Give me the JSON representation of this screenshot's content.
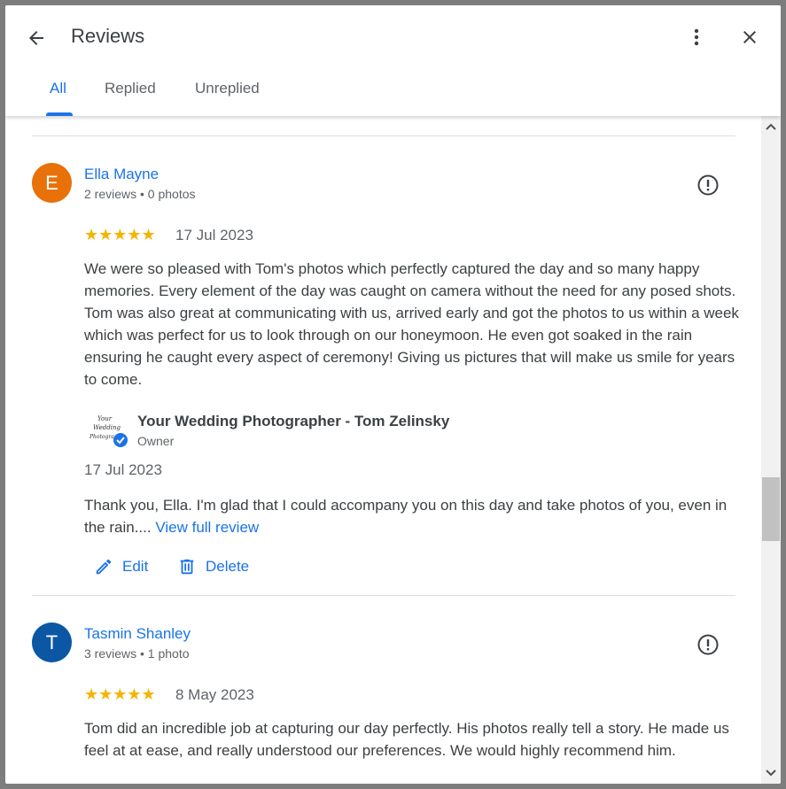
{
  "header": {
    "title": "Reviews",
    "back_icon": "arrow-back-icon",
    "more_icon": "more-vert-icon",
    "close_icon": "close-icon"
  },
  "tabs": [
    {
      "label": "All",
      "active": true
    },
    {
      "label": "Replied",
      "active": false
    },
    {
      "label": "Unreplied",
      "active": false
    }
  ],
  "reviews": [
    {
      "initial": "E",
      "avatar_color": "#e8710a",
      "name": "Ella Mayne",
      "meta": "2 reviews • 0 photos",
      "stars": "★★★★★",
      "rating": 5,
      "date": "17 Jul 2023",
      "text": "We were so pleased with Tom's photos which perfectly captured the day and so many happy memories. Every element of the day was caught on camera without the need for any posed shots. Tom was also great at communicating with us, arrived early and got the photos to us within a week which was perfect for us to look through on our honeymoon. He even got soaked in the rain ensuring he caught every aspect of ceremony! Giving us pictures that will make us smile for years to come.",
      "reply": {
        "owner_name": "Your Wedding Photographer - Tom Zelinsky",
        "owner_role": "Owner",
        "logo_text": [
          "Your",
          "Wedding",
          "Photography"
        ],
        "date": "17 Jul 2023",
        "text": "Thank you, Ella. I'm glad that I could accompany you on this day and take photos of you, even in the rain....",
        "view_full": "View full review",
        "edit_label": "Edit",
        "delete_label": "Delete"
      }
    },
    {
      "initial": "T",
      "avatar_color": "#0b57a4",
      "name": "Tasmin Shanley",
      "meta": "3 reviews • 1 photo",
      "stars": "★★★★★",
      "rating": 5,
      "date": "8 May 2023",
      "text": "Tom did an incredible job at capturing our day perfectly. His photos really tell a story. He made us feel at at ease, and really understood our preferences. We would highly recommend him."
    }
  ],
  "colors": {
    "accent": "#1a73e8",
    "star": "#f4b400",
    "text": "#3c4043",
    "secondary": "#5f6368"
  }
}
